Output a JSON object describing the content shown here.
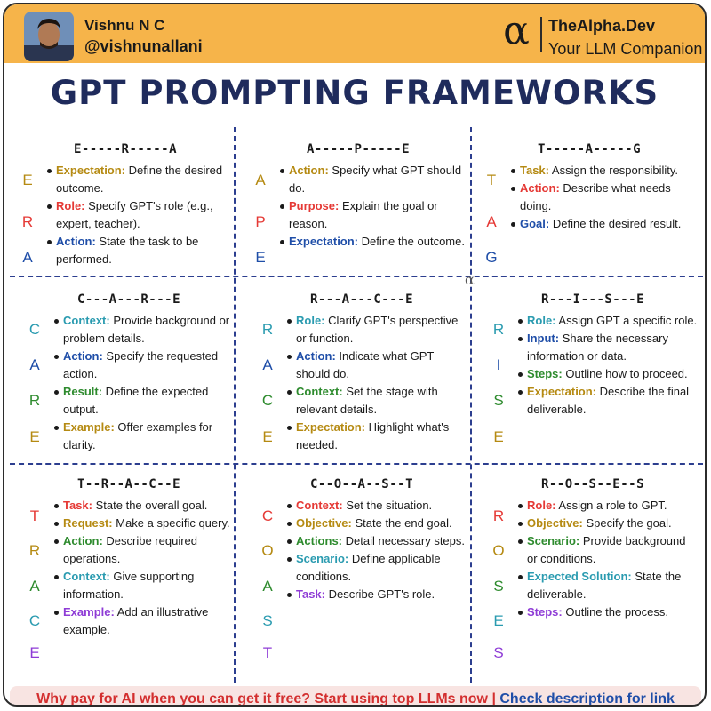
{
  "colors": {
    "header_bg": "#f6b44a",
    "title": "#1f2b5c",
    "divider": "#2c3e8f",
    "gold": "#b58a12",
    "red": "#e53935",
    "blue": "#1f4ea8",
    "green": "#2e8b2e",
    "teal": "#2a9bb0",
    "purple": "#8e3bd6",
    "orange": "#e8891e"
  },
  "header": {
    "author_name": "Vishnu N C",
    "author_handle": "@vishnunallani",
    "brand_logo": "α",
    "brand_name": "TheAlpha.Dev",
    "brand_tagline": "Your LLM Companion"
  },
  "title": "GPT PROMPTING FRAMEWORKS",
  "frameworks": [
    {
      "title": "E-----R-----A",
      "letters": [
        "E",
        "R",
        "A"
      ],
      "items": [
        {
          "key": "Expectation:",
          "text": " Define the desired outcome."
        },
        {
          "key": "Role:",
          "text": " Specify GPT's role (e.g., expert, teacher)."
        },
        {
          "key": "Action:",
          "text": " State the task to be performed."
        }
      ]
    },
    {
      "title": "A-----P-----E",
      "letters": [
        "A",
        "P",
        "E"
      ],
      "items": [
        {
          "key": "Action:",
          "text": " Specify what GPT should do."
        },
        {
          "key": "Purpose:",
          "text": " Explain the goal or reason."
        },
        {
          "key": "Expectation:",
          "text": " Define the outcome."
        }
      ]
    },
    {
      "title": "T-----A-----G",
      "letters": [
        "T",
        "A",
        "G"
      ],
      "items": [
        {
          "key": "Task:",
          "text": " Assign the responsibility."
        },
        {
          "key": "Action:",
          "text": " Describe what needs doing."
        },
        {
          "key": "Goal:",
          "text": " Define the desired result."
        }
      ]
    },
    {
      "title": "C---A---R---E",
      "letters": [
        "C",
        "A",
        "R",
        "E"
      ],
      "items": [
        {
          "key": "Context:",
          "text": " Provide background or problem details."
        },
        {
          "key": "Action:",
          "text": " Specify the requested action."
        },
        {
          "key": "Result:",
          "text": " Define the expected output."
        },
        {
          "key": "Example:",
          "text": " Offer examples for clarity."
        }
      ]
    },
    {
      "title": "R---A---C---E",
      "letters": [
        "R",
        "A",
        "C",
        "E"
      ],
      "items": [
        {
          "key": "Role:",
          "text": " Clarify GPT's perspective or function."
        },
        {
          "key": "Action:",
          "text": " Indicate what GPT should do."
        },
        {
          "key": "Context:",
          "text": " Set the stage with relevant details."
        },
        {
          "key": "Expectation:",
          "text": " Highlight what's needed."
        }
      ]
    },
    {
      "title": "R---I---S---E",
      "letters": [
        "R",
        "I",
        "S",
        "E"
      ],
      "items": [
        {
          "key": "Role:",
          "text": " Assign GPT a specific role."
        },
        {
          "key": "Input:",
          "text": " Share the necessary information or data."
        },
        {
          "key": "Steps:",
          "text": " Outline how to proceed."
        },
        {
          "key": "Expectation:",
          "text": " Describe the final deliverable."
        }
      ]
    },
    {
      "title": "T--R--A--C--E",
      "letters": [
        "T",
        "R",
        "A",
        "C",
        "E"
      ],
      "items": [
        {
          "key": "Task:",
          "text": " State the overall goal."
        },
        {
          "key": "Request:",
          "text": " Make a specific query."
        },
        {
          "key": "Action:",
          "text": " Describe required operations."
        },
        {
          "key": "Context:",
          "text": " Give supporting information."
        },
        {
          "key": "Example:",
          "text": " Add an illustrative example."
        }
      ]
    },
    {
      "title": "C--O--A--S--T",
      "letters": [
        "C",
        "O",
        "A",
        "S",
        "T"
      ],
      "items": [
        {
          "key": "Context:",
          "text": " Set the situation."
        },
        {
          "key": "Objective:",
          "text": " State the end goal."
        },
        {
          "key": "Actions:",
          "text": " Detail necessary steps."
        },
        {
          "key": "Scenario:",
          "text": " Define applicable conditions."
        },
        {
          "key": "Task:",
          "text": " Describe GPT's role."
        }
      ]
    },
    {
      "title": "R--O--S--E--S",
      "letters": [
        "R",
        "O",
        "S",
        "E",
        "S"
      ],
      "items": [
        {
          "key": "Role:",
          "text": " Assign a role to GPT."
        },
        {
          "key": "Objective:",
          "text": " Specify the goal."
        },
        {
          "key": "Scenario:",
          "text": " Provide background or conditions."
        },
        {
          "key": "Expected Solution:",
          "text": " State the deliverable."
        },
        {
          "key": "Steps:",
          "text": " Outline the process."
        }
      ]
    }
  ],
  "center_mark": "α",
  "footer": {
    "promo": "Why pay for AI when you can get it free? Start using top LLMs now | ",
    "link": "Check description for link"
  }
}
